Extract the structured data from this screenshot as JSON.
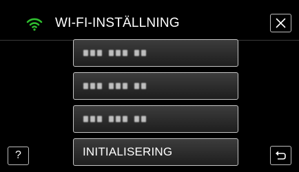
{
  "header": {
    "title": "WI-FI-INSTÄLLNING",
    "wifi_icon": "wifi-icon",
    "close_icon": "close-icon",
    "wifi_color": "#2fbf2f"
  },
  "access_points": [
    {
      "name_masked": true
    },
    {
      "name_masked": true
    },
    {
      "name_masked": true
    }
  ],
  "actions": {
    "initialize_label": "INITIALISERING"
  },
  "footer": {
    "help_label": "?",
    "back_icon": "back-icon"
  }
}
